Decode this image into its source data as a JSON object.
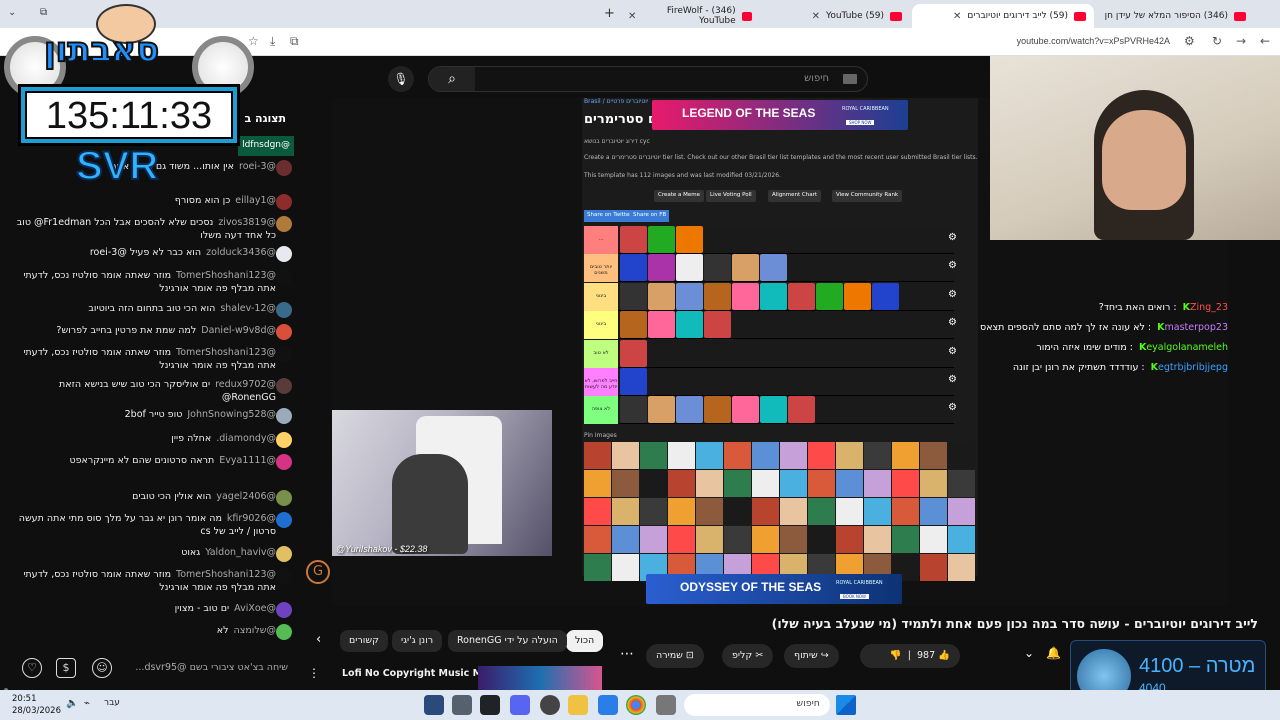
{
  "browser": {
    "tabs": [
      {
        "title": "(346) FireWolf - YouTube"
      },
      {
        "title": "(59) YouTube"
      },
      {
        "title": "(59) לייב דירוגים יוטיוברים"
      },
      {
        "title": "(346) הסיפור המלא של עידן חן"
      }
    ],
    "url": "youtube.com/watch?v=xPsPVRHe42A"
  },
  "overlay": {
    "logo_text": "סאבתון",
    "timer": "135:11:33",
    "tag": "SVR"
  },
  "youtube": {
    "search_placeholder": "חיפוש",
    "live_chat_header": "תצוגה ב",
    "chat_messages": [
      {
        "user": "@roei-3",
        "text": "אין אותו... משוד גם טיאס אחר"
      },
      {
        "user": "@eillay1",
        "text": "כן הוא מסורף"
      },
      {
        "user": "@zivos3819",
        "text": "נסכים שלא להסכים אבל הכל Fr1edman@ טוב כל אחד דעה משלו"
      },
      {
        "user": "@zolduck3436",
        "text": "הוא כבר לא פעיל @roei-3"
      },
      {
        "user": "@TomerShoshani123",
        "text": "מוזר שאתה אומר סולטיז נכס, לדעתי אתה מבלף פה אומר אורגינל"
      },
      {
        "user": "@shalev-12",
        "text": "הוא הכי טוב בתחום הזה ביוטיוב"
      },
      {
        "user": "@Daniel-w9v8d",
        "text": "למה שמת את פרטין בחייב לפרוש?"
      },
      {
        "user": "@TomerShoshani123",
        "text": "מוזר שאתה אומר סולטיז נכס, לדעתי אתה מבלף פה אומר אורגינל"
      },
      {
        "user": "@redux9702",
        "text": "ים אוליסקר הכי טוב שיש בנישא הזאת RonenGG@"
      },
      {
        "user": "@JohnSnowing528",
        "text": "טופ טייר 2bof"
      },
      {
        "user": "@diamondy.",
        "text": "אחלה פיין"
      },
      {
        "user": "@Evya1111",
        "text": "תראה סרטונים שהם לא מיינקראפט"
      },
      {
        "user": "@yagel2406",
        "text": "הוא אולין הכי טובים"
      },
      {
        "user": "@kfir9026",
        "text": "מה אומר רונן יא גבר על מלך סוס מתי אתה תעשה סרטון / לייב של cs"
      },
      {
        "user": "@Yaldon_haviv",
        "text": "גאוט"
      },
      {
        "user": "@TomerShoshani123",
        "text": "מוזר שאתה אומר סולטיז נכס, לדעתי אתה מבלף פה אומר אורגינל"
      },
      {
        "user": "@AviXoe",
        "text": "ים טוב - מצוין"
      },
      {
        "user": "@שלומצה",
        "text": "לא"
      }
    ],
    "chat_input_placeholder": "שיחה בצ'אט ציבורי בשם @dsvr95...",
    "pinned_user": "@ldfnsdgn",
    "video_title": "לייב דירוגים יוטיוברים - עושה סדר במה נכון פעם אחת ולתמיד (מי שנעלב בעיה שלו)",
    "chips": [
      "הכול",
      "הועלה על ידי RonenGG",
      "רונן ג'יגי",
      "קשורים"
    ],
    "actions": {
      "likes": "987",
      "share": "שיתוף",
      "clip": "קליפ",
      "save": "שמירה"
    },
    "recommended_title": "Lofi No Copyright Music Mix",
    "recommended_sub": "022 - Aesthetic Music & Lofi..."
  },
  "tierlist": {
    "title": "...ם סטרימרים",
    "breadcrumb": "Brasil / יוטיוברים פרטיים",
    "sub": "דירוג יוטיוברים בנושא cyc",
    "line1": "Create a יוטיוברים סטרימרים tier list. Check out our other Brasil tier list templates and the most recent user submitted Brasil tier lists.",
    "line2": "This template has 112 images and was last modified 03/21/2026.",
    "buttons": [
      "Create a Meme",
      "Live Voting Poll",
      "Alignment Chart",
      "View Community Rank"
    ],
    "share": [
      "Share on Twitter",
      "Share on FB"
    ],
    "pin": "Pin Images",
    "tiers": [
      "...",
      "יותר טובים משנים",
      "בינוני",
      "בינוני",
      "לא טוב",
      "חייב לפרוש, לא יודע מה לעשות",
      "לא צופה"
    ]
  },
  "ads": [
    {
      "title": "LEGEND OF THE SEAS",
      "brand": "ROYAL CARIBBEAN",
      "cta": "SHOP NOW"
    },
    {
      "title": "ODYSSEY OF THE SEAS",
      "brand": "ROYAL CARIBBEAN",
      "cta": "BOOK NOW"
    }
  ],
  "stream": {
    "donation": "@YuriIshakov - $22.38",
    "overlay_chat": [
      {
        "user": "Zing_23",
        "text": "רואים האת ביחד?"
      },
      {
        "user": "masterpop23",
        "text": "לא עונה אז לך למה סתם להספים תצאס"
      },
      {
        "user": "eyalgolanameleh",
        "text": "מודים שימו איזה הימור"
      },
      {
        "user": "egtrbjbribjjepg",
        "text": "עודדדד תשתיק את רונן יבן זונה"
      }
    ],
    "goal_label": "מטרה",
    "goal_main": "4100",
    "goal_sub": "4040"
  },
  "taskbar": {
    "time": "20:51",
    "date": "28/03/2026",
    "lang": "עבר",
    "search": "חיפוש"
  },
  "colors": {
    "yt_red": "#ff0033",
    "kick_green": "#53fc18",
    "accent_blue": "#1b9ed6"
  }
}
